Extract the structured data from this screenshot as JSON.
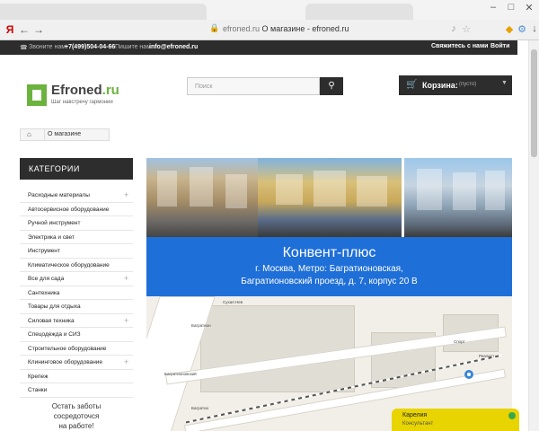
{
  "browser": {
    "title_right": "О магазине - efroned.ru",
    "address_domain": "efroned.ru",
    "address_title": "О магазине - efroned.ru",
    "back_icon": "back-arrow-icon",
    "forward_icon": "forward-arrow-icon",
    "reload_icon": "reload-icon",
    "y_label": "Я"
  },
  "topbar": {
    "call_label": "Звоните нам:",
    "phone": "+7(499)504-04-66",
    "write_label": "Пишите нам:",
    "email": "info@efroned.ru",
    "contact": "Свяжитесь с нами",
    "login": "Войти"
  },
  "logo": {
    "name": "Efroned",
    "suffix": ".ru",
    "tagline": "Шаг навстречу гармонии"
  },
  "search": {
    "placeholder": "Поиск"
  },
  "cart": {
    "label": "Корзина:",
    "status": "(пусто)"
  },
  "breadcrumb": {
    "current": "О магазине"
  },
  "sidebar": {
    "title": "КАТЕГОРИИ",
    "items": [
      {
        "label": "Расходные материалы",
        "has_sub": true
      },
      {
        "label": "Автосервисное оборудование",
        "has_sub": false
      },
      {
        "label": "Ручной инструмент",
        "has_sub": false
      },
      {
        "label": "Электрика и свет",
        "has_sub": false
      },
      {
        "label": "Инструмент",
        "has_sub": false
      },
      {
        "label": "Климатическое оборудование",
        "has_sub": false
      },
      {
        "label": "Все для сада",
        "has_sub": true
      },
      {
        "label": "Сантехника",
        "has_sub": false
      },
      {
        "label": "Товары для отдыха",
        "has_sub": false
      },
      {
        "label": "Силовая техника",
        "has_sub": true
      },
      {
        "label": "Спецодежда и СИЗ",
        "has_sub": false
      },
      {
        "label": "Строительное оборудование",
        "has_sub": false
      },
      {
        "label": "Клининговое оборудование",
        "has_sub": true
      },
      {
        "label": "Крепеж",
        "has_sub": false
      },
      {
        "label": "Станки",
        "has_sub": false
      }
    ],
    "promo_line1": "Остать заботы",
    "promo_line2": "сосредоточся",
    "promo_line3": "на работе!"
  },
  "banner": {
    "title": "Конвент-плюс",
    "line1": "г. Москва, Метро: Багратионовская,",
    "line2": "Багратионовский проезд, д. 7, корпус 20 В"
  },
  "map_labels": {
    "street1": "Сухая Нев",
    "street2": "Багратион",
    "street3": "Багратионовский",
    "street4": "Багратио",
    "shop1": "Спорт",
    "shop2": "Реалист"
  },
  "consultant": {
    "name": "Карелия",
    "role": "Консультант"
  }
}
